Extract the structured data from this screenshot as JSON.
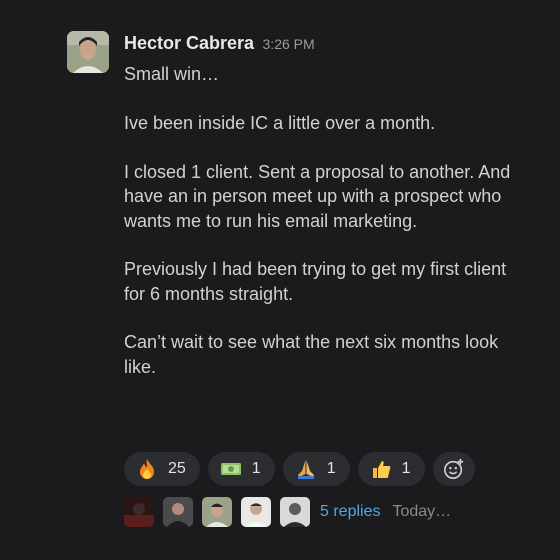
{
  "message": {
    "author": "Hector Cabrera",
    "timestamp": "3:26 PM",
    "paragraphs": [
      "Small win…\n\nIve been inside IC a little over a month.",
      "I closed 1 client. Sent a proposal to another. And have an in person meet up with a prospect who wants me to run his email marketing.",
      "Previously I had been trying to get my first client for 6 months straight.",
      "Can’t wait to see what the next six months look like."
    ]
  },
  "reactions": [
    {
      "icon": "fire-emoji",
      "count": "25"
    },
    {
      "icon": "money-emoji",
      "count": "1"
    },
    {
      "icon": "praying-hands-emoji",
      "count": "1"
    },
    {
      "icon": "thumbs-up-emoji",
      "count": "1"
    }
  ],
  "add_reaction_icon": "add-emoji-icon",
  "thread": {
    "replies_label": "5 replies",
    "last_reply": "Today…"
  },
  "colors": {
    "background": "#1b1b1e",
    "link": "#4fa8e8",
    "pill": "#2c2d30"
  }
}
